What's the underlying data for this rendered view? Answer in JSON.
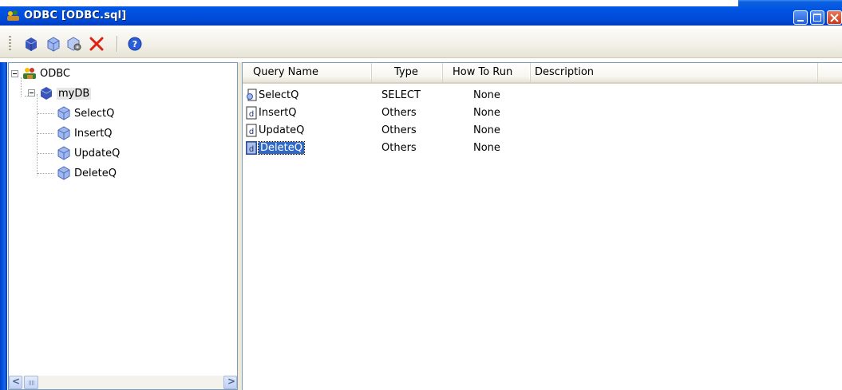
{
  "window": {
    "title": "ODBC [ODBC.sql]"
  },
  "colors": {
    "titlebar": "#0054e3",
    "selection": "#316ac5",
    "toolbar": "#f1efe6"
  },
  "toolbar": {
    "buttons": [
      {
        "icon": "database-icon"
      },
      {
        "icon": "query-cube-icon"
      },
      {
        "icon": "query-settings-icon"
      },
      {
        "icon": "delete-x-icon"
      },
      {
        "icon": "help-icon"
      }
    ]
  },
  "tree": {
    "root": {
      "label": "ODBC",
      "icon": "odbc-people-icon"
    },
    "database": {
      "label": "myDB",
      "icon": "database-icon"
    },
    "queries": [
      {
        "label": "SelectQ"
      },
      {
        "label": "InsertQ"
      },
      {
        "label": "UpdateQ"
      },
      {
        "label": "DeleteQ"
      }
    ]
  },
  "list": {
    "columns": [
      "Query Name",
      "Type",
      "How To Run",
      "Description"
    ],
    "rows": [
      {
        "name": "SelectQ",
        "type": "SELECT",
        "how_to_run": "None",
        "description": "",
        "selected": false
      },
      {
        "name": "InsertQ",
        "type": "Others",
        "how_to_run": "None",
        "description": "",
        "selected": false
      },
      {
        "name": "UpdateQ",
        "type": "Others",
        "how_to_run": "None",
        "description": "",
        "selected": false
      },
      {
        "name": "DeleteQ",
        "type": "Others",
        "how_to_run": "None",
        "description": "",
        "selected": true
      }
    ]
  },
  "scrollbar": {
    "left_arrow": "<",
    "right_arrow": ">"
  }
}
